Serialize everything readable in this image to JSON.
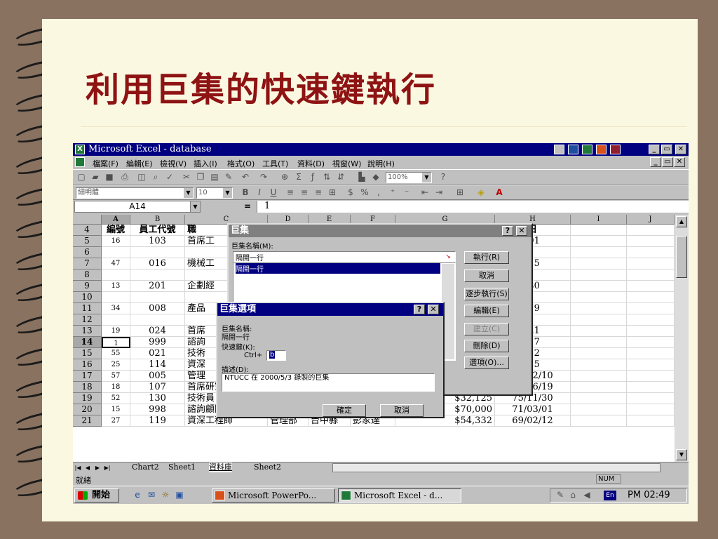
{
  "slide": {
    "title": "利用巨集的快速鍵執行"
  },
  "excel": {
    "title": "Microsoft Excel - database",
    "menu": [
      "檔案(F)",
      "編輯(E)",
      "檢視(V)",
      "插入(I)",
      "格式(O)",
      "工具(T)",
      "資料(D)",
      "視窗(W)",
      "說明(H)"
    ],
    "zoom": "100%",
    "font_name": "細明體",
    "font_size": "10",
    "name_box": "A14",
    "formula_value": "1",
    "columns": [
      "A",
      "B",
      "C",
      "D",
      "E",
      "F",
      "G",
      "H",
      "I",
      "J"
    ],
    "rows": [
      {
        "n": "4",
        "cells": [
          "編號",
          "員工代號",
          "職",
          "",
          "",
          "",
          "",
          "日",
          "",
          ""
        ]
      },
      {
        "n": "5",
        "cells": [
          "16",
          "103",
          "首席工",
          "",
          "",
          "",
          "",
          "/01",
          "",
          ""
        ]
      },
      {
        "n": "6",
        "cells": [
          "",
          "",
          "",
          "",
          "",
          "",
          "",
          "",
          "",
          ""
        ]
      },
      {
        "n": "7",
        "cells": [
          "47",
          "016",
          "機械工",
          "",
          "",
          "",
          "",
          "/15",
          "",
          ""
        ]
      },
      {
        "n": "8",
        "cells": [
          "",
          "",
          "",
          "",
          "",
          "",
          "",
          "",
          "",
          ""
        ]
      },
      {
        "n": "9",
        "cells": [
          "13",
          "201",
          "企劃經",
          "",
          "",
          "",
          "",
          "/30",
          "",
          ""
        ]
      },
      {
        "n": "10",
        "cells": [
          "",
          "",
          "",
          "",
          "",
          "",
          "",
          "",
          "",
          ""
        ]
      },
      {
        "n": "11",
        "cells": [
          "34",
          "008",
          "產品",
          "",
          "",
          "",
          "",
          "/19",
          "",
          ""
        ]
      },
      {
        "n": "12",
        "cells": [
          "",
          "",
          "",
          "",
          "",
          "",
          "",
          "",
          "",
          ""
        ]
      },
      {
        "n": "13",
        "cells": [
          "19",
          "024",
          "首席",
          "",
          "",
          "",
          "",
          "/21",
          "",
          ""
        ]
      },
      {
        "n": "14",
        "cells": [
          "1",
          "999",
          "諮詢",
          "",
          "",
          "",
          "",
          "/17",
          "",
          ""
        ]
      },
      {
        "n": "15",
        "cells": [
          "55",
          "021",
          "技術",
          "",
          "",
          "",
          "",
          "/12",
          "",
          ""
        ]
      },
      {
        "n": "16",
        "cells": [
          "25",
          "114",
          "資深",
          "",
          "",
          "",
          "",
          "/15",
          "",
          ""
        ]
      },
      {
        "n": "17",
        "cells": [
          "57",
          "005",
          "管理",
          "",
          "",
          "",
          ",512",
          "79/12/10",
          "",
          ""
        ]
      },
      {
        "n": "18",
        "cells": [
          "18",
          "107",
          "首席研究員",
          "研發部",
          "台中縣",
          "陳麗",
          ",308",
          "73/06/19",
          "",
          ""
        ]
      },
      {
        "n": "19",
        "cells": [
          "52",
          "130",
          "技術員",
          "研發部",
          "台中縣",
          "王朝悟",
          "$32,125",
          "75/11/30",
          "",
          ""
        ]
      },
      {
        "n": "20",
        "cells": [
          "15",
          "998",
          "諮詢顧問",
          "業務部",
          "台中縣",
          "鄭　昱",
          "$70,000",
          "71/03/01",
          "",
          ""
        ]
      },
      {
        "n": "21",
        "cells": [
          "27",
          "119",
          "資深工程師",
          "管理部",
          "台中縣",
          "彭家達",
          "$54,332",
          "69/02/12",
          "",
          ""
        ]
      }
    ],
    "sheet_tabs": [
      "Chart2",
      "Sheet1",
      "資料庫",
      "Sheet2"
    ],
    "status": "就緒",
    "num_indicator": "NUM"
  },
  "macro_dialog": {
    "title": "巨集",
    "name_label": "巨集名稱(M):",
    "name_value": "隔開一行",
    "list_item": "隔開一行",
    "buttons": [
      "執行(R)",
      "取消",
      "逐步執行(S)",
      "編輯(E)",
      "建立(C)",
      "刪除(D)",
      "選項(O)..."
    ]
  },
  "options_dialog": {
    "title": "巨集選項",
    "name_label": "巨集名稱:",
    "name_value": "隔開一行",
    "shortcut_label": "快速鍵(K):",
    "ctrl_label": "Ctrl+",
    "shortcut_key": "b",
    "desc_label": "描述(D):",
    "desc_value": "NTUCC 在 2000/5/3 錄製的巨集",
    "ok": "確定",
    "cancel": "取消"
  },
  "taskbar": {
    "start": "開始",
    "items": [
      "Microsoft PowerPo...",
      "Microsoft Excel - d..."
    ],
    "lang": "En",
    "clock": "PM 02:49"
  }
}
